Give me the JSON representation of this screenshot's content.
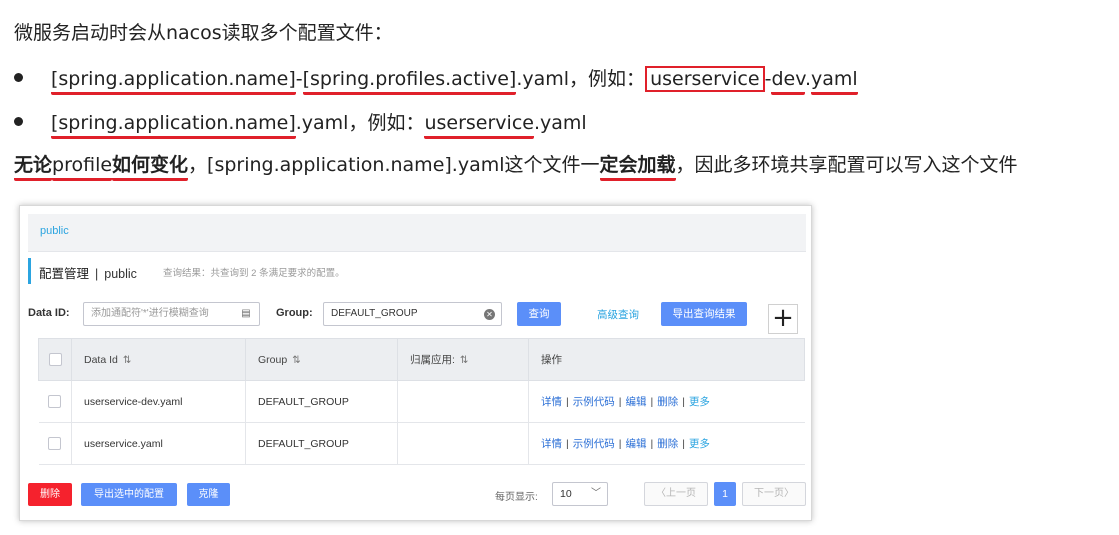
{
  "slide": {
    "title": "微服务启动时会从nacos读取多个配置文件：",
    "bullet1": {
      "part1": "[spring.application.name]",
      "dash": "-",
      "part2": "[spring.profiles.active]",
      "suffix": ".yaml，例如：",
      "ex_boxed": "userservice",
      "ex_dash": "-",
      "ex_dev": "dev",
      "ex_dot": ".",
      "ex_yaml": "yaml"
    },
    "bullet2": {
      "part1": "[spring.application.name]",
      "suffix": ".yaml，例如：",
      "ex_name": "userservice",
      "ex_ext": ".yaml"
    },
    "line3": {
      "a": "无论",
      "b": "profile",
      "c": "如何变化",
      "d": "，[spring.application.name].yaml这个文件一",
      "e": "定会加载",
      "f": "，因此多环境共享配置可以写入这个文件"
    }
  },
  "nacos": {
    "namespace_tab": "public",
    "header": {
      "title": "配置管理",
      "separator": "|",
      "namespace": "public",
      "result_info": "查询结果：共查询到 2 条满足要求的配置。"
    },
    "search": {
      "data_id_label": "Data ID:",
      "data_id_placeholder": "添加通配符'*'进行模糊查询",
      "group_label": "Group:",
      "group_value": "DEFAULT_GROUP",
      "query_button": "查询",
      "advanced_query": "高级查询",
      "export_button": "导出查询结果",
      "add_button": "+"
    },
    "table": {
      "columns": [
        "Data Id",
        "Group",
        "归属应用:",
        "操作"
      ],
      "sort_icon": "⇅",
      "rows": [
        {
          "data_id": "userservice-dev.yaml",
          "group": "DEFAULT_GROUP",
          "app": ""
        },
        {
          "data_id": "userservice.yaml",
          "group": "DEFAULT_GROUP",
          "app": ""
        }
      ],
      "ops": {
        "detail": "详情",
        "sample": "示例代码",
        "edit": "编辑",
        "delete": "删除",
        "more": "更多",
        "sep": "|"
      }
    },
    "footer": {
      "delete_button": "删除",
      "export_selected_button": "导出选中的配置",
      "clone_button": "克隆",
      "page_size_label": "每页显示:",
      "page_size_value": "10",
      "prev": "上一页",
      "current_page": "1",
      "next": "下一页"
    },
    "colors": {
      "primary": "#5b8ff9",
      "danger": "#f5222d",
      "link": "#2ba4e0",
      "underline": "#e0202a"
    }
  }
}
